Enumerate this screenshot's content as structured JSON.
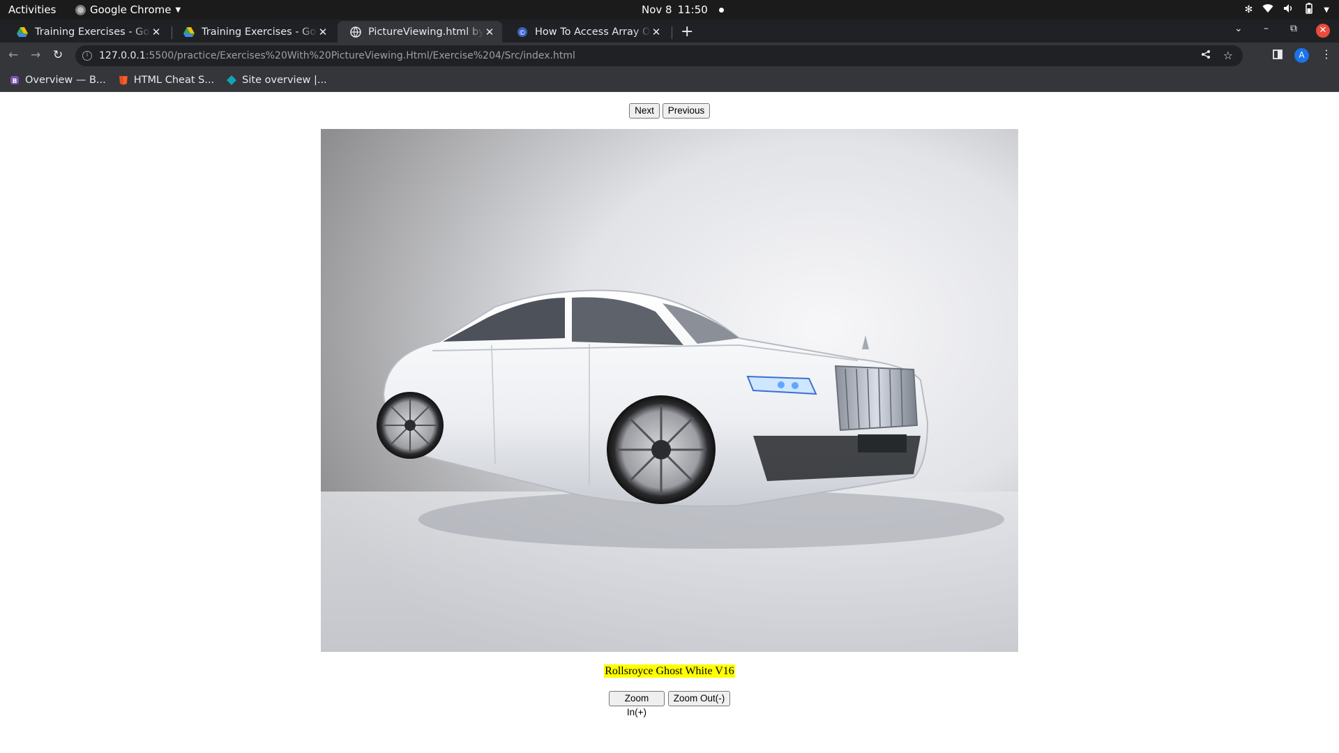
{
  "system_bar": {
    "activities": "Activities",
    "app_name": "Google Chrome",
    "date": "Nov 8",
    "time": "11:50"
  },
  "tabs": [
    {
      "title": "Training Exercises - Google",
      "favicon": "google-drive-icon",
      "active": false
    },
    {
      "title": "Training Exercises - Google",
      "favicon": "google-drive-icon",
      "active": false
    },
    {
      "title": "PictureViewing.html by Ka",
      "favicon": "globe-icon",
      "active": true
    },
    {
      "title": "How To Access Array Of O",
      "favicon": "codeproject-icon",
      "active": false
    }
  ],
  "address_bar": {
    "host": "127.0.0.1",
    "path": ":5500/practice/Exercises%20With%20PictureViewing.Html/Exercise%204/Src/index.html"
  },
  "profile_initial": "A",
  "bookmarks": [
    {
      "label": "Overview — B...",
      "icon": "bootstrap-icon"
    },
    {
      "label": "HTML Cheat S...",
      "icon": "html5-icon"
    },
    {
      "label": "Site overview |...",
      "icon": "diamond-icon"
    }
  ],
  "page": {
    "next_label": "Next",
    "previous_label": "Previous",
    "image_alt": "white luxury sedan photo",
    "caption": "Rollsroyce Ghost White V16",
    "zoom_in_label": "Zoom In(+)",
    "zoom_out_label": "Zoom Out(-)"
  },
  "colors": {
    "caption_highlight": "#ffff00",
    "tab_active": "#35363a",
    "tab_strip": "#202124",
    "close_button": "#e94b3c"
  }
}
